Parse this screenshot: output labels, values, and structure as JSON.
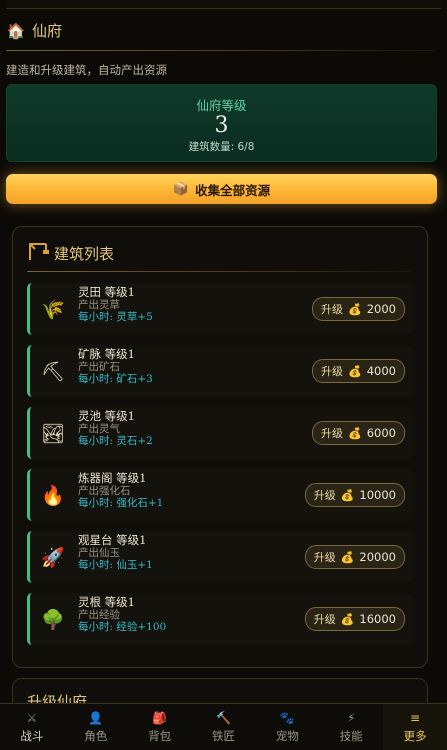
{
  "section": {
    "title": "仙府",
    "icon": "house-icon",
    "description": "建造和升级建筑，自动产出资源"
  },
  "level_card": {
    "label": "仙府等级",
    "value": "3",
    "count_text": "建筑数量: 6/8"
  },
  "collect_button": {
    "label": "收集全部资源",
    "icon": "box-icon"
  },
  "building_list": {
    "title": "建筑列表",
    "icon": "crane-icon",
    "items": [
      {
        "name": "灵田 等级1",
        "produce": "产出灵草",
        "rate": "每小时: 灵草+5",
        "upgrade_label": "升级",
        "cost": "2000",
        "icon": "grain-icon"
      },
      {
        "name": "矿脉 等级1",
        "produce": "产出矿石",
        "rate": "每小时: 矿石+3",
        "upgrade_label": "升级",
        "cost": "4000",
        "icon": "pickaxe-icon"
      },
      {
        "name": "灵池 等级1",
        "produce": "产出灵气",
        "rate": "每小时: 灵石+2",
        "upgrade_label": "升级",
        "cost": "6000",
        "icon": "landscape-icon"
      },
      {
        "name": "炼器阁 等级1",
        "produce": "产出强化石",
        "rate": "每小时: 强化石+1",
        "upgrade_label": "升级",
        "cost": "10000",
        "icon": "fire-icon"
      },
      {
        "name": "观星台 等级1",
        "produce": "产出仙玉",
        "rate": "每小时: 仙玉+1",
        "upgrade_label": "升级",
        "cost": "20000",
        "icon": "rocket-icon"
      },
      {
        "name": "灵根 等级1",
        "produce": "产出经验",
        "rate": "每小时: 经验+100",
        "upgrade_label": "升级",
        "cost": "16000",
        "icon": "tree-icon"
      }
    ]
  },
  "next_section": {
    "title": "升级仙府"
  },
  "bottom_nav": [
    {
      "label": "战斗",
      "icon": "swords-icon"
    },
    {
      "label": "角色",
      "icon": "person-icon"
    },
    {
      "label": "背包",
      "icon": "bag-icon"
    },
    {
      "label": "铁匠",
      "icon": "hammer-icon"
    },
    {
      "label": "宠物",
      "icon": "paw-icon"
    },
    {
      "label": "技能",
      "icon": "lightning-icon"
    },
    {
      "label": "更多",
      "icon": "menu-icon"
    }
  ],
  "colors": {
    "accent_gold": "#e2c77a",
    "rate_cyan": "#37b9c8",
    "level_green": "#5fd1a6",
    "row_border_green": "#3fbf8a",
    "collect_button": "#fcb535"
  }
}
